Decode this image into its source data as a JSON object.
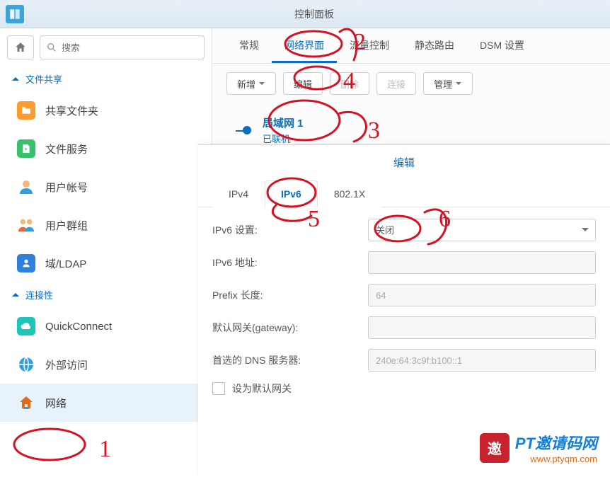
{
  "window": {
    "title": "控制面板"
  },
  "search": {
    "placeholder": "搜索"
  },
  "sidebar": {
    "group_fileshare": "文件共享",
    "group_connectivity": "连接性",
    "items": {
      "shared_folder": "共享文件夹",
      "file_services": "文件服务",
      "user_account": "用户帐号",
      "user_group": "用户群组",
      "domain_ldap": "域/LDAP",
      "quickconnect": "QuickConnect",
      "external_access": "外部访问",
      "network": "网络"
    }
  },
  "tabs": {
    "general": "常规",
    "network_interface": "网络界面",
    "traffic_control": "流量控制",
    "static_route": "静态路由",
    "dsm_settings": "DSM 设置"
  },
  "toolbar": {
    "add": "新增",
    "edit": "编辑",
    "delete": "删除",
    "connect": "连接",
    "manage": "管理"
  },
  "lan": {
    "name": "局域网 1",
    "status": "已联机"
  },
  "dialog": {
    "title": "编辑",
    "tabs": {
      "ipv4": "IPv4",
      "ipv6": "IPv6",
      "dot1x": "802.1X"
    },
    "form": {
      "ipv6_setting_label": "IPv6 设置:",
      "ipv6_setting_value": "关闭",
      "ipv6_address_label": "IPv6 地址:",
      "ipv6_address_value": "",
      "prefix_label": "Prefix 长度:",
      "prefix_value": "64",
      "gateway_label": "默认网关(gateway):",
      "gateway_value": "",
      "dns_label": "首选的 DNS 服务器:",
      "dns_value": "240e:64:3c9f:b100::1",
      "default_gw_checkbox": "设为默认网关"
    }
  },
  "watermark": {
    "seal": "邀",
    "line1": "PT邀请码网",
    "line2": "www.ptyqm.com"
  }
}
